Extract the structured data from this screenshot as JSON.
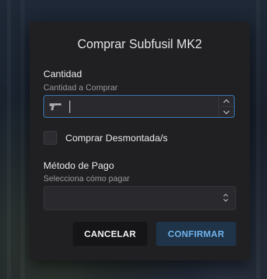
{
  "dialog": {
    "title": "Comprar Subfusil MK2",
    "quantity": {
      "label": "Cantidad",
      "hint": "Cantidad a Comprar",
      "value": "",
      "icon": "pistol-icon",
      "stepper_up_icon": "chevron-up-icon",
      "stepper_down_icon": "chevron-down-icon"
    },
    "disassembled": {
      "label": "Comprar Desmontada/s",
      "checked": false
    },
    "payment": {
      "label": "Método de Pago",
      "hint": "Selecciona cómo pagar",
      "selected": "",
      "icon": "select-arrows-icon"
    },
    "buttons": {
      "cancel": "CANCELAR",
      "confirm": "CONFIRMAR"
    }
  },
  "colors": {
    "dialog_bg": "#202023",
    "input_focus_border": "#3b82c4",
    "confirm_bg": "#1f3448",
    "confirm_text": "#6fb3ee",
    "cancel_bg": "#151518"
  }
}
